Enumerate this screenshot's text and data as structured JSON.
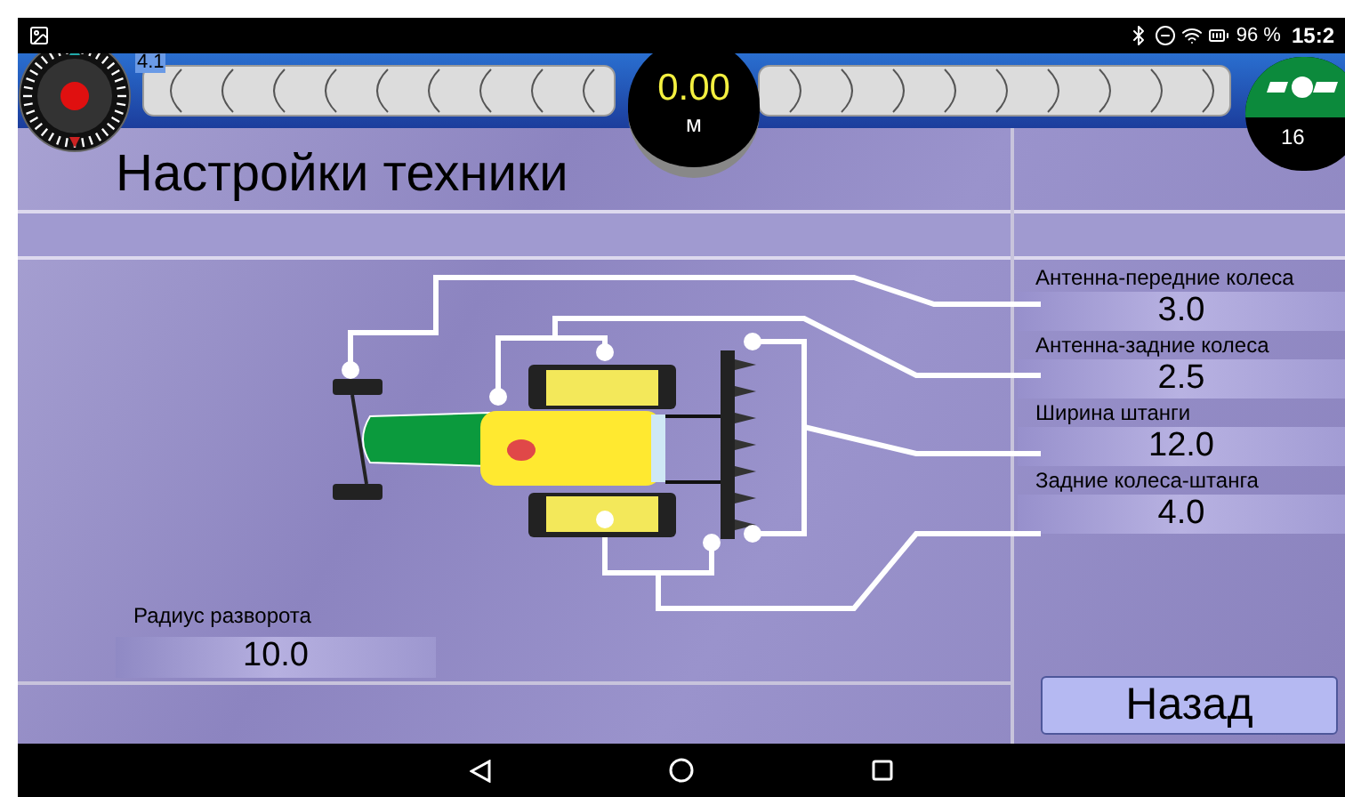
{
  "status_bar": {
    "battery": "96 %",
    "time": "15:2"
  },
  "compass": {
    "label": "4.1"
  },
  "speed": {
    "value": "0.00",
    "unit": "м"
  },
  "satellites": {
    "count": "16"
  },
  "title": "Настройки техники",
  "fields": [
    {
      "label": "Антенна-передние колеса",
      "value": "3.0"
    },
    {
      "label": "Антенна-задние колеса",
      "value": "2.5"
    },
    {
      "label": "Ширина штанги",
      "value": "12.0"
    },
    {
      "label": "Задние колеса-штанга",
      "value": "4.0"
    }
  ],
  "turn_radius": {
    "label": "Радиус разворота",
    "value": "10.0"
  },
  "back_button": "Назад"
}
